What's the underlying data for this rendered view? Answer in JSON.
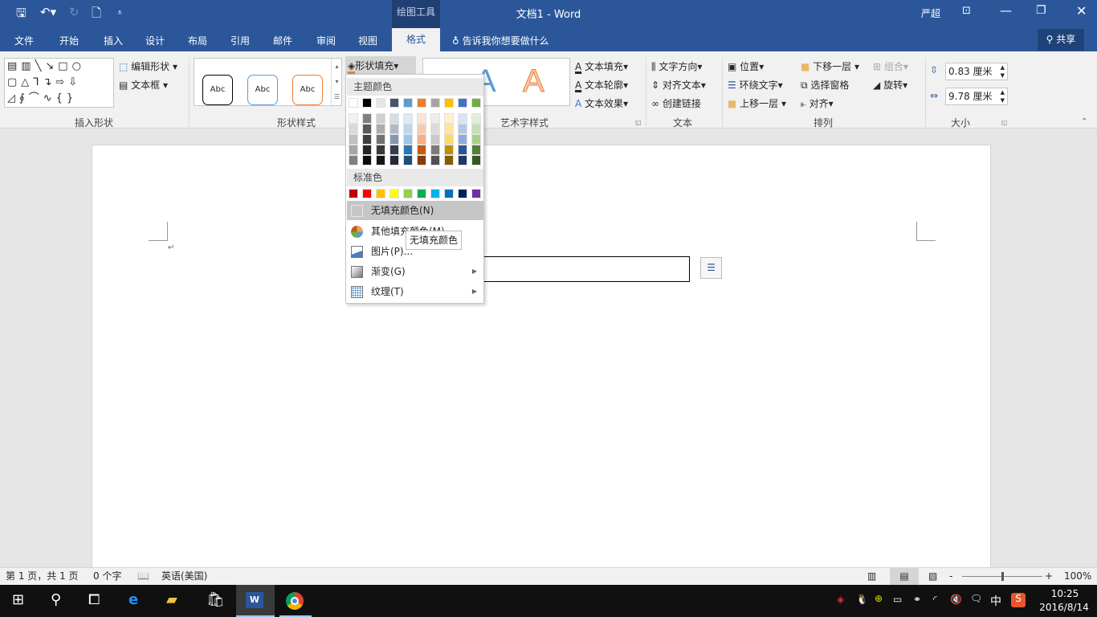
{
  "titlebar": {
    "context_tab": "绘图工具",
    "title": "文档1 - Word",
    "user": "严超",
    "share": "共享",
    "tell_me": "告诉我你想要做什么"
  },
  "tabs": [
    "文件",
    "开始",
    "插入",
    "设计",
    "布局",
    "引用",
    "邮件",
    "审阅",
    "视图",
    "格式"
  ],
  "active_tab": "格式",
  "ribbon": {
    "insert_shapes": {
      "label": "插入形状",
      "edit_shape": "编辑形状",
      "text_box": "文本框"
    },
    "shape_styles": {
      "label": "形状样式",
      "sample": "Abc",
      "fill": "形状填充"
    },
    "wordart_styles": {
      "label": "艺术字样式",
      "sample": "A",
      "text_fill": "文本填充",
      "text_outline": "文本轮廓",
      "text_effects": "文本效果"
    },
    "text": {
      "label": "文本",
      "direction": "文字方向",
      "align": "对齐文本",
      "link": "创建链接"
    },
    "arrange": {
      "label": "排列",
      "position": "位置",
      "wrap": "环绕文字",
      "forward": "上移一层",
      "backward": "下移一层",
      "selection_pane": "选择窗格",
      "align": "对齐",
      "group": "组合",
      "rotate": "旋转"
    },
    "size": {
      "label": "大小",
      "height": "0.83 厘米",
      "width": "9.78 厘米"
    }
  },
  "fill_menu": {
    "theme_header": "主题颜色",
    "standard_header": "标准色",
    "theme_colors": [
      "#ffffff",
      "#000000",
      "#e7e6e6",
      "#44546a",
      "#5b9bd5",
      "#ed7d31",
      "#a5a5a5",
      "#ffc000",
      "#4472c4",
      "#70ad47"
    ],
    "theme_shades": [
      [
        "#f2f2f2",
        "#d9d9d9",
        "#bfbfbf",
        "#a6a6a6",
        "#808080"
      ],
      [
        "#808080",
        "#595959",
        "#404040",
        "#262626",
        "#0d0d0d"
      ],
      [
        "#d0cece",
        "#aeabab",
        "#757171",
        "#3a3838",
        "#171616"
      ],
      [
        "#d6dce4",
        "#adb9ca",
        "#8496b0",
        "#333f4f",
        "#222a35"
      ],
      [
        "#deebf6",
        "#bdd7ee",
        "#9dc3e6",
        "#2e75b5",
        "#1f4e79"
      ],
      [
        "#fbe5d5",
        "#f8cbad",
        "#f4b183",
        "#c55a11",
        "#843c0c"
      ],
      [
        "#ededed",
        "#dbdbdb",
        "#c9c9c9",
        "#7b7b7b",
        "#525252"
      ],
      [
        "#fff2cc",
        "#ffe699",
        "#ffd966",
        "#bf9000",
        "#7f6000"
      ],
      [
        "#dae3f3",
        "#b4c7e7",
        "#8faadc",
        "#2f5597",
        "#1f3864"
      ],
      [
        "#e2efd9",
        "#c5e0b3",
        "#a8d08d",
        "#538135",
        "#375623"
      ]
    ],
    "standard_colors": [
      "#c00000",
      "#ff0000",
      "#ffc000",
      "#ffff00",
      "#92d050",
      "#00b050",
      "#00b0f0",
      "#0070c0",
      "#002060",
      "#7030a0"
    ],
    "items": [
      "无填充颜色(N)",
      "其他填充颜色(M)...",
      "图片(P)...",
      "渐变(G)",
      "纹理(T)"
    ],
    "tooltip": "无填充颜色"
  },
  "status": {
    "page": "第 1 页，共 1 页",
    "words": "0 个字",
    "language": "英语(美国)",
    "zoom": "100%",
    "zoom_percent": 100
  },
  "taskbar": {
    "ime": "中",
    "time": "10:25",
    "date": "2016/8/14"
  }
}
